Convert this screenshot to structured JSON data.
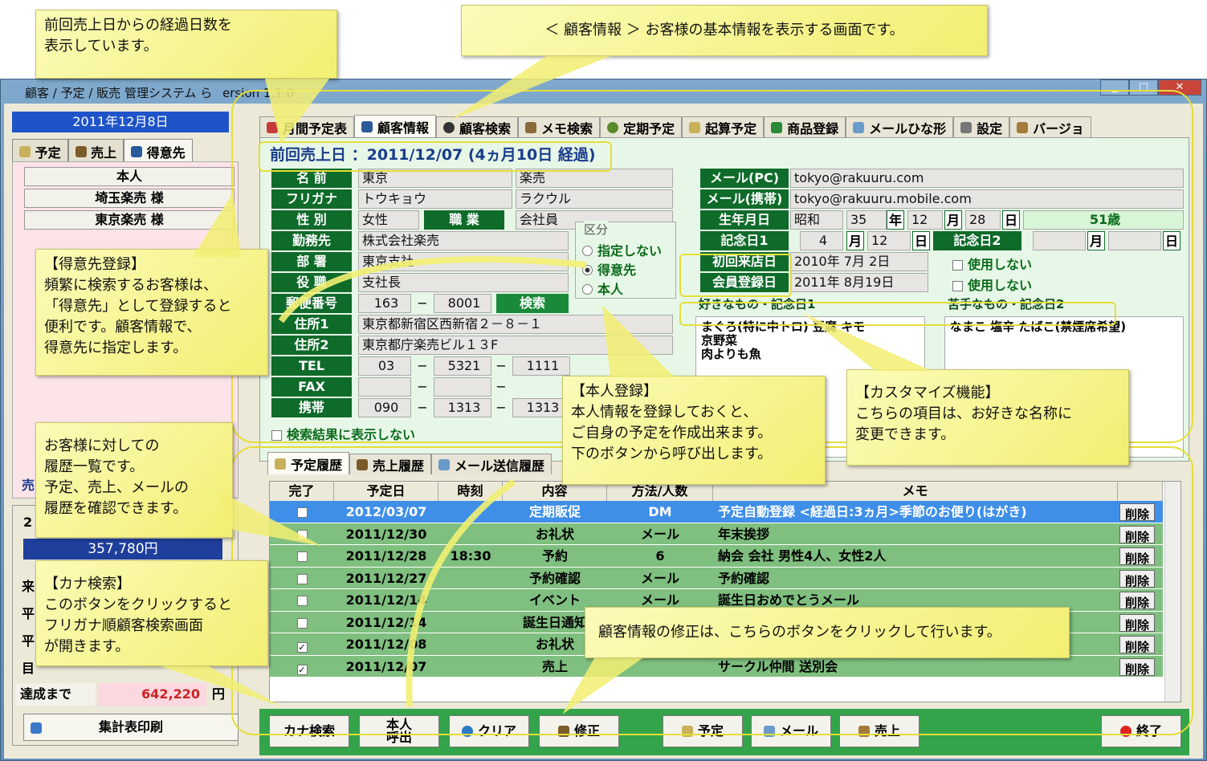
{
  "window": {
    "title": "顧客 / 予定 / 販売 管理システム ら",
    "version": "ersion 1.1.0"
  },
  "left": {
    "date": "2011年12月8日",
    "tabs": [
      "予定",
      "売上",
      "得意先"
    ],
    "customers": [
      "本人",
      "埼玉楽売 様",
      "東京楽売 様"
    ],
    "amount": "357,780円",
    "tassei_label": "達成まで",
    "tassei_value": "642,220",
    "tassei_unit": "円",
    "print": "集計表印刷",
    "side_texts": [
      "売",
      "2",
      "来",
      "平",
      "平",
      "目"
    ]
  },
  "tabs": [
    "月間予定表",
    "顧客情報",
    "顧客検索",
    "メモ検索",
    "定期予定",
    "起算予定",
    "商品登録",
    "メールひな形",
    "設定",
    "バージョ"
  ],
  "form": {
    "last_sale": "前回売上日 ：2011/12/07 (4ヵ月10日 経過)",
    "labels": {
      "name": "名 前",
      "furigana": "フリガナ",
      "sex": "性 別",
      "job": "職 業",
      "work": "勤務先",
      "dept": "部 署",
      "post": "役 職",
      "zip": "郵便番号",
      "addr1": "住所1",
      "addr2": "住所2",
      "tel": "TEL",
      "fax": "FAX",
      "mobile": "携帯"
    },
    "values": {
      "name1": "東京",
      "name2": "楽売",
      "furi1": "トウキョウ",
      "furi2": "ラクウル",
      "sex": "女性",
      "job": "会社員",
      "work": "株式会社楽売",
      "dept": "東京支社",
      "post": "支社長",
      "zip1": "163",
      "zip2": "8001",
      "zip_btn": "検索",
      "addr1": "東京都新宿区西新宿２－８－１",
      "addr2": "東京都庁楽売ビル１３F",
      "tel1": "03",
      "tel2": "5321",
      "tel3": "1111",
      "mob1": "090",
      "mob2": "1313",
      "mob3": "1313"
    },
    "kubun_title": "区分",
    "kubun": [
      "指定しない",
      "得意先",
      "本人"
    ],
    "no_search": "検索結果に表示しない",
    "r_labels": {
      "mail_pc": "メール(PC)",
      "mail_mobile": "メール(携帯)",
      "birthday": "生年月日",
      "anniv1": "記念日1",
      "anniv2": "記念日2",
      "first": "初回来店日",
      "member": "会員登録日"
    },
    "r_values": {
      "mail_pc": "tokyo@rakuuru.com",
      "mail_mobile": "tokyo@rakuuru.mobile.com",
      "era": "昭和",
      "byear": "35",
      "by": "年",
      "bmonth": "12",
      "bm": "月",
      "bday": "28",
      "bd": "日",
      "age": "51歳",
      "a1m": "4",
      "a1mu": "月",
      "a1d": "12",
      "a1du": "日",
      "a2mu": "月",
      "a2du": "日",
      "first": "2010年 7月 2日",
      "member": "2011年 8月19日",
      "nouse": "使用しない"
    },
    "likes_label": "好きなもの・記念日1",
    "dislikes_label": "苦手なもの・記念日2",
    "likes": "まぐろ(特に中トロ) 豆腐 キモ\n京野菜\n肉よりも魚",
    "dislikes": "なまこ 塩辛 たばこ(禁煙席希望)"
  },
  "history": {
    "tabs": [
      "予定履歴",
      "売上履歴",
      "メール送信履歴"
    ],
    "headers": [
      "完了",
      "予定日",
      "時刻",
      "内容",
      "方法/人数",
      "メモ"
    ],
    "rows": [
      {
        "done": false,
        "date": "2012/03/07",
        "time": "",
        "content": "定期販促",
        "method": "DM",
        "memo": "予定自動登録 <経過日:3ヵ月>季節のお便り(はがき)",
        "del": "削除"
      },
      {
        "done": false,
        "date": "2011/12/30",
        "time": "",
        "content": "お礼状",
        "method": "メール",
        "memo": "年末挨拶",
        "del": "削除"
      },
      {
        "done": false,
        "date": "2011/12/28",
        "time": "18:30",
        "content": "予約",
        "method": "6",
        "memo": "納会 会社 男性4人、女性2人",
        "del": "削除"
      },
      {
        "done": false,
        "date": "2011/12/27",
        "time": "",
        "content": "予約確認",
        "method": "メール",
        "memo": "予約確認",
        "del": "削除"
      },
      {
        "done": false,
        "date": "2011/12/14",
        "time": "",
        "content": "イベント",
        "method": "メール",
        "memo": "誕生日おめでとうメール",
        "del": "削除"
      },
      {
        "done": false,
        "date": "2011/12/14",
        "time": "",
        "content": "誕生日通知",
        "method": "",
        "memo": "",
        "del": "削除"
      },
      {
        "done": true,
        "date": "2011/12/08",
        "time": "",
        "content": "お礼状",
        "method": "",
        "memo": "",
        "del": "削除"
      },
      {
        "done": true,
        "date": "2011/12/07",
        "time": "",
        "content": "売上",
        "method": "",
        "memo": "サークル仲間 送別会",
        "del": "削除"
      }
    ]
  },
  "buttons": {
    "kana": "カナ検索",
    "self": "本人\n呼出",
    "clear": "クリア",
    "edit": "修正",
    "plan": "予定",
    "mail": "メール",
    "sale": "売上",
    "end": "終了"
  },
  "callouts": {
    "c1": "前回売上日からの経過日数を\n表示しています。",
    "c2": "＜ 顧客情報 ＞ お客様の基本情報を表示する画面です。",
    "c3": "【得意先登録】\n頻繁に検索するお客様は、\n「得意先」として登録すると\n便利です。顧客情報で、\n得意先に指定します。",
    "c4": "【本人登録】\n本人情報を登録しておくと、\nご自身の予定を作成出来ます。\n下のボタンから呼び出します。",
    "c5": "【カスタマイズ機能】\nこちらの項目は、お好きな名称に\n変更できます。",
    "c6": "お客様に対しての\n履歴一覧です。\n予定、売上、メールの\n履歴を確認できます。",
    "c7": "【カナ検索】\nこのボタンをクリックすると\nフリガナ順顧客検索画面\nが開きます。",
    "c8": "顧客情報の修正は、こちらのボタンをクリックして行います。"
  },
  "colors": {
    "green_label": "#0f6b2a",
    "callout": "#f2ef72",
    "selected_row": "#3f8fe9",
    "row": "#7fbf7f"
  }
}
